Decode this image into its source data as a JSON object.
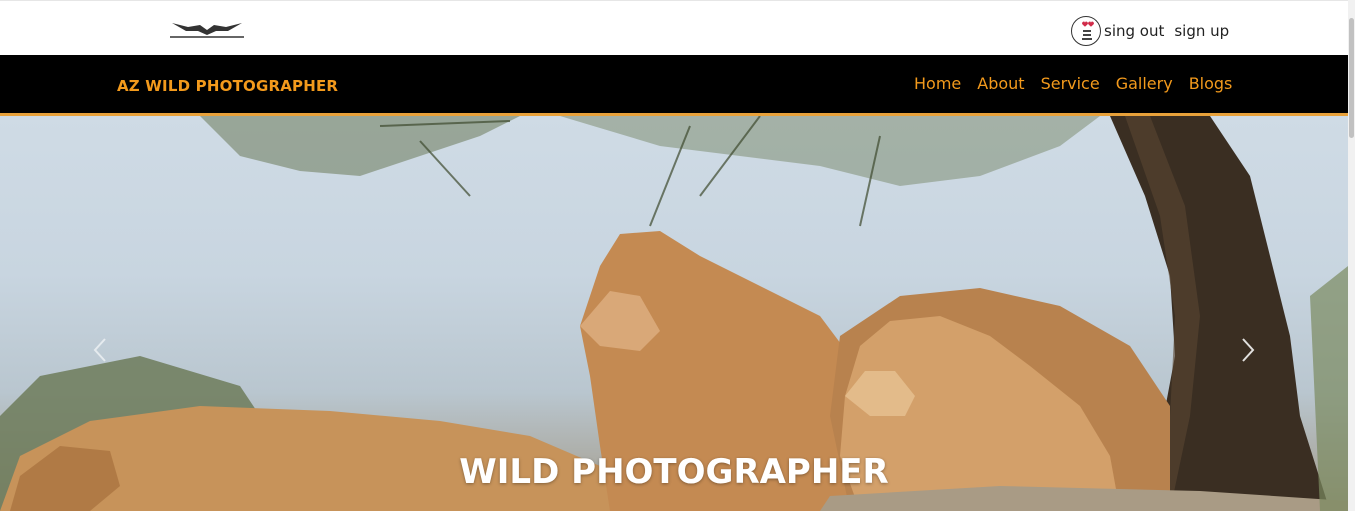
{
  "header": {
    "logo_icon": "eagle-logo-icon",
    "avatar_icon": "profile-avatar-icon",
    "sign_out_label": "sing out",
    "sign_up_label": "sign up"
  },
  "navbar": {
    "brand": "AZ WILD PHOTOGRAPHER",
    "links": [
      "Home",
      "About",
      "Service",
      "Gallery",
      "Blogs"
    ],
    "accent_color": "#f39a1c",
    "background_color": "#000000"
  },
  "hero": {
    "title": "WILD PHOTOGRAPHER",
    "subtitle": "",
    "prev_icon": "chevron-left-icon",
    "next_icon": "chevron-right-icon"
  }
}
